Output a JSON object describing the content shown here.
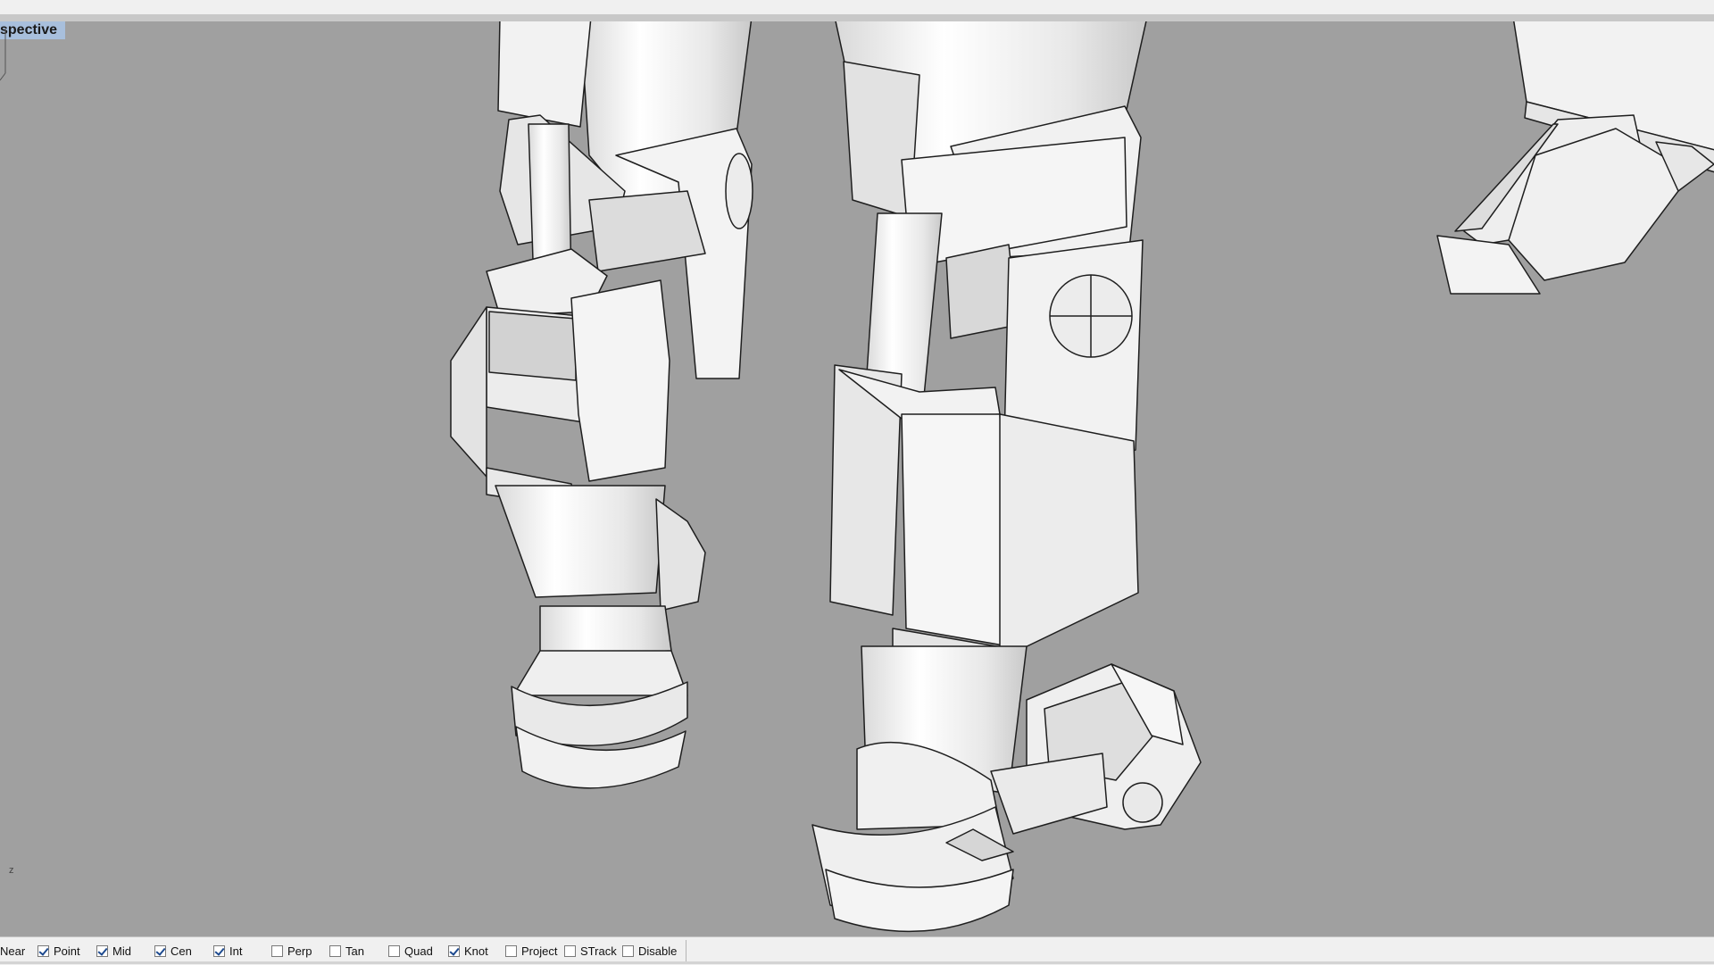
{
  "viewport": {
    "title": "spective",
    "axis_label": "z"
  },
  "osnap": [
    {
      "label": "Near",
      "checked": null
    },
    {
      "label": "Point",
      "checked": true
    },
    {
      "label": "Mid",
      "checked": true
    },
    {
      "label": "Cen",
      "checked": true
    },
    {
      "label": "Int",
      "checked": true
    },
    {
      "label": "Perp",
      "checked": false
    },
    {
      "label": "Tan",
      "checked": false
    },
    {
      "label": "Quad",
      "checked": false
    },
    {
      "label": "Knot",
      "checked": true
    },
    {
      "label": "Project",
      "checked": false
    },
    {
      "label": "STrack",
      "checked": false
    },
    {
      "label": "Disable",
      "checked": false
    }
  ],
  "colors": {
    "viewport_bg": "#a0a0a0",
    "title_bg": "#a8bfdc",
    "model_fill": "#f2f2f2",
    "model_edge": "#1e1e1e"
  }
}
